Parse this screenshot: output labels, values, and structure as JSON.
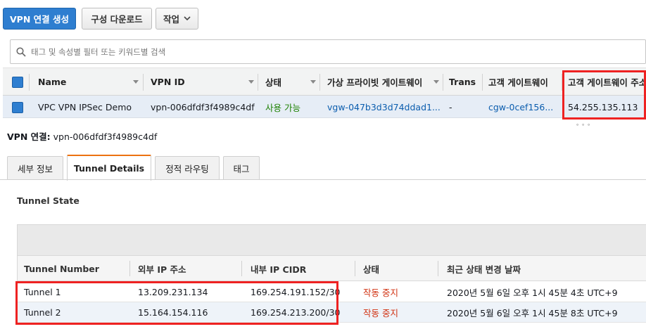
{
  "toolbar": {
    "create_vpn_label": "VPN 연결 생성",
    "download_config_label": "구성 다운로드",
    "actions_label": "작업"
  },
  "search": {
    "placeholder": "태그 및 속성별 필터 또는 키워드별 검색",
    "value": ""
  },
  "grid": {
    "columns": [
      "Name",
      "VPN ID",
      "상태",
      "가상 프라이빗 게이트웨이",
      "Trans",
      "고객 게이트웨이",
      "고객 게이트웨이 주소"
    ],
    "rows": [
      {
        "name": "VPC VPN IPSec Demo",
        "vpn_id": "vpn-006dfdf3f4989c4df",
        "state": "사용 가능",
        "vgw": "vgw-047b3d3d74ddad1...",
        "transit": "-",
        "cgw": "cgw-0cef156...",
        "cgw_address": "54.255.135.113",
        "selected": true
      }
    ]
  },
  "detail": {
    "title_label": "VPN 연결:",
    "title_value": "vpn-006dfdf3f4989c4df",
    "tabs": [
      {
        "label": "세부 정보",
        "active": false
      },
      {
        "label": "Tunnel Details",
        "active": true
      },
      {
        "label": "정적 라우팅",
        "active": false
      },
      {
        "label": "태그",
        "active": false
      }
    ],
    "section_title": "Tunnel State",
    "tunnel_columns": [
      "Tunnel Number",
      "외부 IP 주소",
      "내부 IP CIDR",
      "상태",
      "최근 상태 변경 날짜"
    ],
    "tunnels": [
      {
        "number": "Tunnel 1",
        "outside_ip": "13.209.231.134",
        "inside_cidr": "169.254.191.152/30",
        "status": "작동 중지",
        "last_change": "2020년 5월 6일 오후 1시 45분 4초 UTC+9"
      },
      {
        "number": "Tunnel 2",
        "outside_ip": "15.164.154.116",
        "inside_cidr": "169.254.213.200/30",
        "status": "작동 중지",
        "last_change": "2020년 5월 6일 오후 1시 45분 8초 UTC+9"
      }
    ]
  },
  "colors": {
    "primary": "#2e7ed0",
    "available_green": "#1d8102",
    "stopped_red": "#d13212",
    "highlight_box": "#ee2222",
    "active_tab_accent": "#ec7211"
  },
  "icons": {
    "search": "search-icon",
    "actions_dropdown": "chevron-down-icon",
    "resize_handle": "resize-handle-icon"
  }
}
